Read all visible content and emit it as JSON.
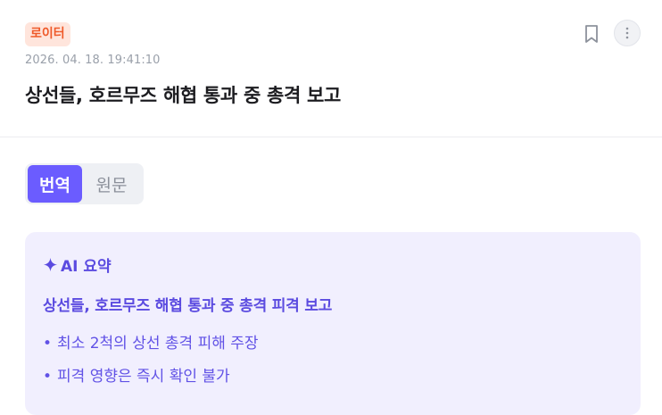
{
  "article": {
    "source": "로이터",
    "timestamp": "2026. 04. 18. 19:41:10",
    "title": "상선들, 호르무즈 해협 통과 중 총격 보고"
  },
  "actions": {
    "bookmark_icon": "bookmark-icon",
    "more_icon": "more-vertical-icon"
  },
  "language_toggle": {
    "options": [
      "번역",
      "원문"
    ],
    "selected": "번역"
  },
  "ai_summary": {
    "title": "AI 요약",
    "icon": "sparkle-icon",
    "headline": "상선들, 호르무즈 해협 통과 중 총격 피격 보고",
    "bullets": [
      "최소 2척의 상선 총격 피해 주장",
      "피격 영향은 즉시 확인 불가"
    ]
  },
  "colors": {
    "accent": "#6b5cff",
    "source_badge_bg": "#ffe5dc",
    "source_badge_text": "#ef5a2a",
    "summary_bg": "#f1effe"
  }
}
